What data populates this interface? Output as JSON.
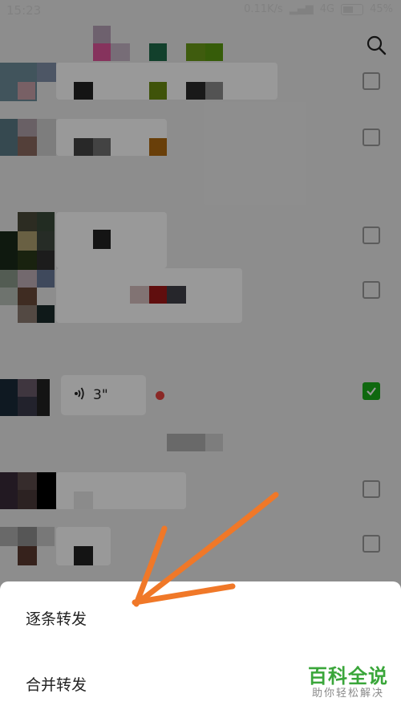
{
  "status_bar": {
    "time": "15:23",
    "network": "0.11K/s",
    "signal": "4G",
    "battery": "45%"
  },
  "voice_message": {
    "duration": "3\""
  },
  "checkboxes": {
    "checked_index": 4
  },
  "bottom_sheet": {
    "option_one": "逐条转发",
    "option_two": "合并转发"
  },
  "watermark": {
    "title": "百科全说",
    "subtitle": "助你轻松解决"
  },
  "colors": {
    "accent_green": "#1aad19",
    "arrow_orange": "#f07828",
    "unread_red": "#e64340"
  },
  "icons": [
    "search-icon",
    "voice-icon",
    "checkbox-icon",
    "checkmark-icon",
    "battery-icon",
    "signal-icon"
  ]
}
